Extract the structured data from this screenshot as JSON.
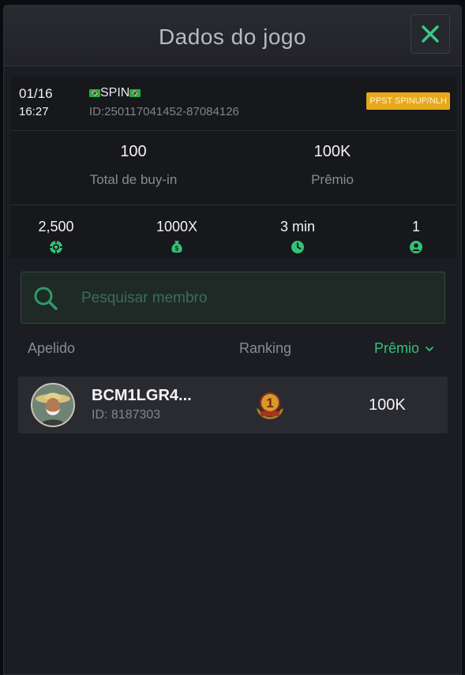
{
  "header": {
    "title": "Dados do jogo"
  },
  "game": {
    "date": "01/16",
    "time": "16:27",
    "type": "SPIN",
    "id": "ID:250117041452-87084126",
    "tag": "PPST SPINUP/NLH"
  },
  "stats": {
    "buyin_value": "100",
    "buyin_label": "Total de buy-in",
    "prize_value": "100K",
    "prize_label": "Prêmio"
  },
  "mini": {
    "chips": "2,500",
    "multiplier": "1000X",
    "duration": "3 min",
    "players": "1"
  },
  "search": {
    "placeholder": "Pesquisar membro"
  },
  "columns": {
    "nickname": "Apelido",
    "ranking": "Ranking",
    "prize": "Prêmio"
  },
  "players": [
    {
      "name": "BCM1LGR4...",
      "id": "ID: 8187303",
      "rank": "1",
      "prize": "100K"
    }
  ],
  "colors": {
    "accent": "#33c178",
    "tag": "#e7a91a",
    "medal": "#c8891e"
  }
}
